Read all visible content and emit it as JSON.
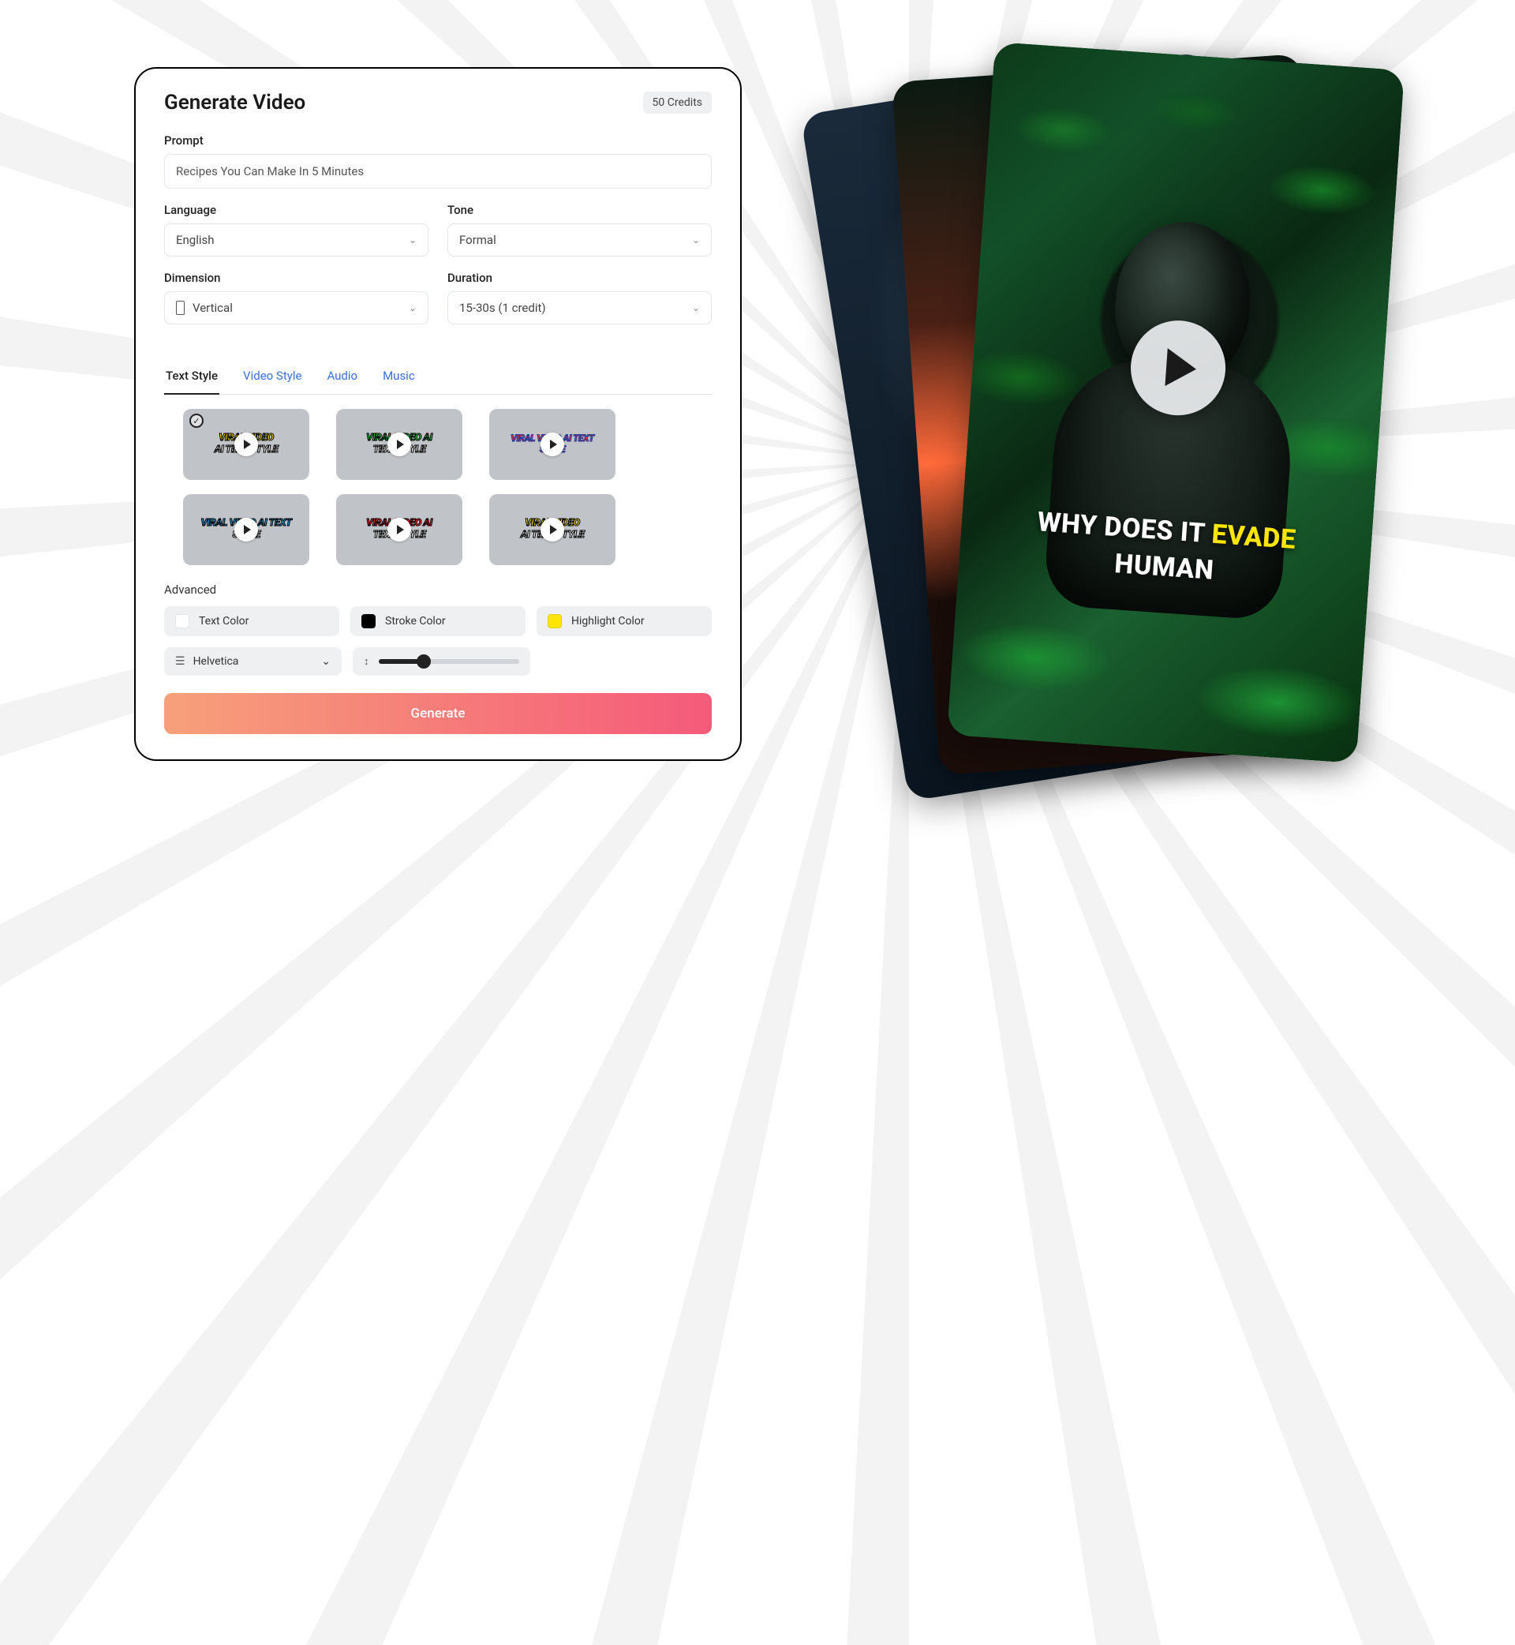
{
  "panel": {
    "title": "Generate Video",
    "credits": "50 Credits",
    "prompt_label": "Prompt",
    "prompt_value": "Recipes You Can Make In 5 Minutes",
    "language_label": "Language",
    "language_value": "English",
    "tone_label": "Tone",
    "tone_value": "Formal",
    "dimension_label": "Dimension",
    "dimension_value": "Vertical",
    "duration_label": "Duration",
    "duration_value": "15-30s (1 credit)"
  },
  "tabs": [
    {
      "label": "Text Style",
      "active": true
    },
    {
      "label": "Video Style",
      "active": false
    },
    {
      "label": "Audio",
      "active": false
    },
    {
      "label": "Music",
      "active": false
    }
  ],
  "text_styles": [
    {
      "selected": true,
      "line1": "VIRAL VIDEO",
      "line2": "AI TEXT STYLE"
    },
    {
      "selected": false,
      "line1": "VIRAL VIDEO AI",
      "line2": "TEXT STYLE"
    },
    {
      "selected": false,
      "line1": "VIRAL VIDEO AI TEXT",
      "line2": "STYLE"
    },
    {
      "selected": false,
      "line1": "VIRAL VIDEO AI TEXT",
      "line2": "STYLE"
    },
    {
      "selected": false,
      "line1": "VIRAL VIDEO AI",
      "line2": "TEXT STYLE"
    },
    {
      "selected": false,
      "line1": "VIRAL VIDEO",
      "line2": "AI TEXT STYLE"
    }
  ],
  "advanced": {
    "label": "Advanced",
    "text_color_label": "Text Color",
    "text_color_value": "#ffffff",
    "stroke_color_label": "Stroke Color",
    "stroke_color_value": "#000000",
    "highlight_color_label": "Highlight Color",
    "highlight_color_value": "#ffe600",
    "font_value": "Helvetica",
    "size_percent": 32
  },
  "generate_label": "Generate",
  "preview": {
    "caption_pre": "WHY DOES IT ",
    "caption_highlight": "EVADE",
    "caption_post": "HUMAN"
  }
}
